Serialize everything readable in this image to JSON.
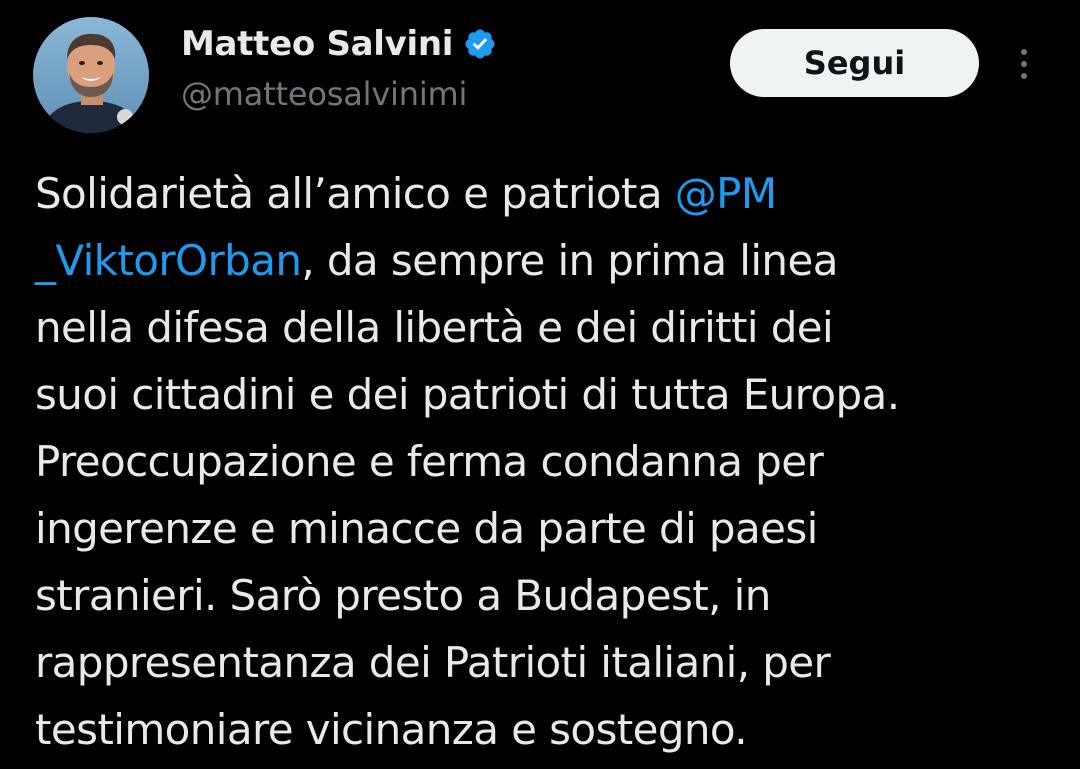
{
  "author": {
    "name": "Matteo Salvini",
    "handle": "@matteosalvinimi",
    "verified_icon": "verified-badge-icon",
    "verified_color": "#1d9bf0"
  },
  "actions": {
    "follow_label": "Segui",
    "more_icon": "more-vertical-icon"
  },
  "tweet": {
    "lines": [
      [
        {
          "text": "Solidarietà all’amico e patriota "
        },
        {
          "text": "@PM",
          "mention": true
        }
      ],
      [
        {
          "text": "_ViktorOrban",
          "mention": true
        },
        {
          "text": ", da sempre in prima linea"
        }
      ],
      [
        {
          "text": "nella difesa della libertà e dei diritti dei"
        }
      ],
      [
        {
          "text": "suoi cittadini e dei patrioti di tutta Europa."
        }
      ],
      [
        {
          "text": "Preoccupazione e ferma condanna per"
        }
      ],
      [
        {
          "text": "ingerenze e minacce da parte di paesi"
        }
      ],
      [
        {
          "text": "stranieri. Sarò presto a Budapest, in"
        }
      ],
      [
        {
          "text": "rappresentanza dei Patrioti italiani, per"
        }
      ],
      [
        {
          "text": "testimoniare vicinanza e sostegno."
        }
      ]
    ]
  },
  "colors": {
    "background": "#000000",
    "text": "#e7e9ea",
    "secondary": "#71767b",
    "accent": "#1d9bf0",
    "button_bg": "#eff3f4"
  }
}
